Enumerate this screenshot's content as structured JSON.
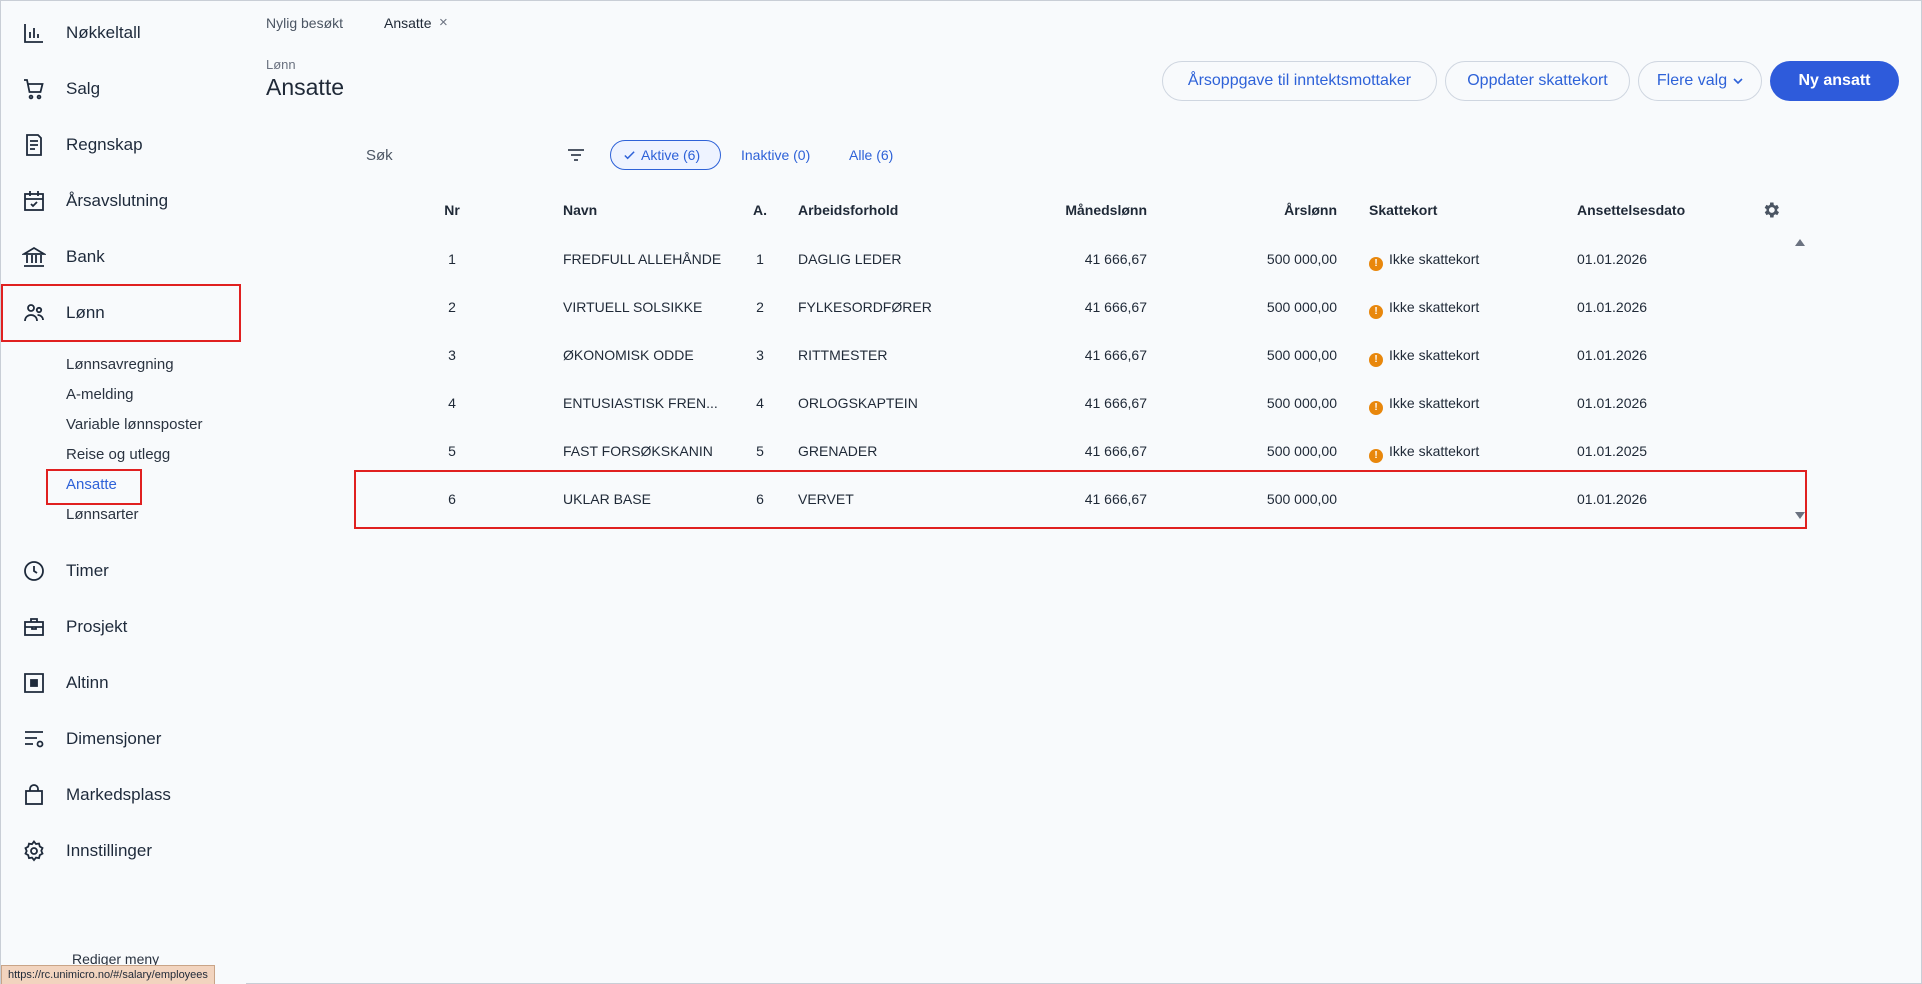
{
  "sidebar": {
    "items": [
      {
        "label": "Nøkkeltall",
        "icon": "bar-chart-icon"
      },
      {
        "label": "Salg",
        "icon": "cart-icon"
      },
      {
        "label": "Regnskap",
        "icon": "ledger-icon"
      },
      {
        "label": "Årsavslutning",
        "icon": "calendar-check-icon"
      },
      {
        "label": "Bank",
        "icon": "bank-icon"
      },
      {
        "label": "Lønn",
        "icon": "people-icon"
      },
      {
        "label": "Timer",
        "icon": "clock-icon"
      },
      {
        "label": "Prosjekt",
        "icon": "briefcase-icon"
      },
      {
        "label": "Altinn",
        "icon": "square-dot-icon"
      },
      {
        "label": "Dimensjoner",
        "icon": "filter-settings-icon"
      },
      {
        "label": "Markedsplass",
        "icon": "shopping-bag-icon"
      },
      {
        "label": "Innstillinger",
        "icon": "gear-icon"
      }
    ],
    "sub_items": [
      "Lønnsavregning",
      "A-melding",
      "Variable lønnsposter",
      "Reise og utlegg",
      "Ansatte",
      "Lønnsarter"
    ],
    "edit_menu": "Rediger meny"
  },
  "status_url": "https://rc.unimicro.no/#/salary/employees",
  "tabs": {
    "recent": "Nylig besøkt",
    "active": "Ansatte",
    "close": "×"
  },
  "header": {
    "breadcrumb": "Lønn",
    "title": "Ansatte"
  },
  "actions": {
    "annual": "Årsoppgave til inntektsmottaker",
    "update_tax": "Oppdater skattekort",
    "more": "Flere valg",
    "new_employee": "Ny ansatt"
  },
  "filters": {
    "search_placeholder": "Søk",
    "active": "Aktive (6)",
    "inactive": "Inaktive (0)",
    "all": "Alle (6)"
  },
  "table": {
    "columns": [
      "Nr",
      "Navn",
      "A.",
      "Arbeidsforhold",
      "Månedslønn",
      "Årslønn",
      "Skattekort",
      "Ansettelsesdato"
    ],
    "rows": [
      [
        "1",
        "FREDFULL ALLEHÅNDE",
        "1",
        "DAGLIG LEDER",
        "41 666,67",
        "500 000,00",
        "Ikke skattekort",
        "01.01.2026"
      ],
      [
        "2",
        "VIRTUELL SOLSIKKE",
        "2",
        "FYLKESORDFØRER",
        "41 666,67",
        "500 000,00",
        "Ikke skattekort",
        "01.01.2026"
      ],
      [
        "3",
        "ØKONOMISK ODDE",
        "3",
        "RITTMESTER",
        "41 666,67",
        "500 000,00",
        "Ikke skattekort",
        "01.01.2026"
      ],
      [
        "4",
        "ENTUSIASTISK FREN...",
        "4",
        "ORLOGSKAPTEIN",
        "41 666,67",
        "500 000,00",
        "Ikke skattekort",
        "01.01.2026"
      ],
      [
        "5",
        "FAST FORSØKSKANIN",
        "5",
        "GRENADER",
        "41 666,67",
        "500 000,00",
        "Ikke skattekort",
        "01.01.2025"
      ],
      [
        "6",
        "UKLAR BASE",
        "6",
        "VERVET",
        "41 666,67",
        "500 000,00",
        "",
        "01.01.2026"
      ]
    ]
  },
  "colors": {
    "accent": "#2e5bdb",
    "highlight": "#e02020",
    "warning": "#e8870c"
  }
}
